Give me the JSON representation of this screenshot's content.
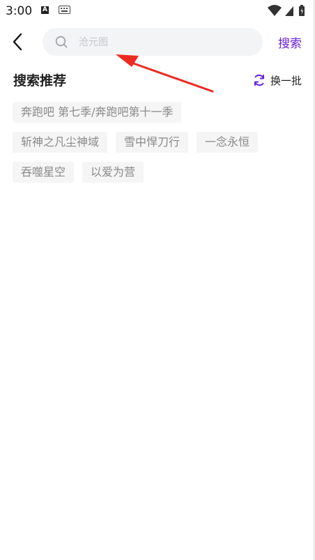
{
  "status_bar": {
    "time": "3:00",
    "a_icon_letter": "A"
  },
  "header": {
    "search_placeholder": "沧元图",
    "search_value": "",
    "search_button": "搜索"
  },
  "section": {
    "title": "搜索推荐",
    "refresh_label": "换一批"
  },
  "tag_rows": [
    [
      "奔跑吧 第七季/奔跑吧第十一季"
    ],
    [
      "斩神之凡尘神域",
      "雪中悍刀行",
      "一念永恒"
    ],
    [
      "吞噬星空",
      "以爱为营"
    ]
  ],
  "colors": {
    "accent": "#6a1fdc",
    "tag_bg": "#f5f5f5",
    "tag_text": "#8a8a8a",
    "annotation": "#ee2b22"
  }
}
